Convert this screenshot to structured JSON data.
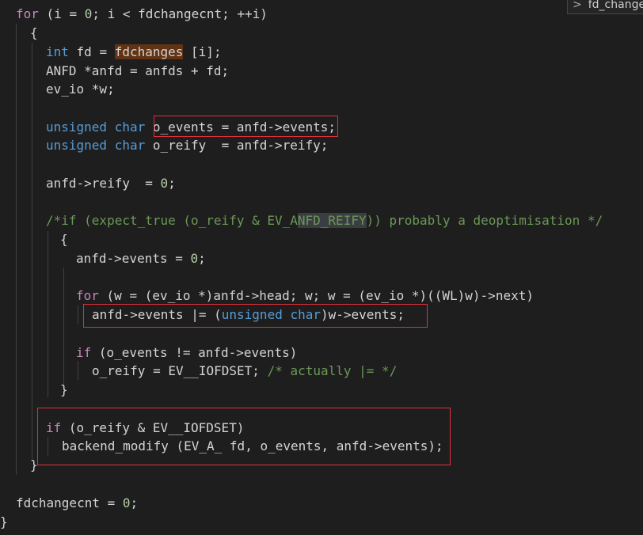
{
  "breadcrumb": {
    "chevron": "chevron-right-icon",
    "label": "fd_changes"
  },
  "code": {
    "l1": {
      "kw": "for",
      "rest1": " (i = ",
      "n0": "0",
      "rest2": "; i < fdchangecnt; ++i)"
    },
    "l2": {
      "t": "{"
    },
    "l3": {
      "kw": "int",
      "a": " fd = ",
      "hl": "fdchanges",
      "b": " [i];"
    },
    "l4": {
      "t": "ANFD *anfd = anfds + fd;"
    },
    "l5": {
      "t": "ev_io *w;"
    },
    "l6": {
      "kw": "unsigned char",
      "a": " o_events = anfd->events;"
    },
    "l7": {
      "kw": "unsigned char",
      "a": " o_reify  = anfd->reify;"
    },
    "l8": {
      "a": "anfd->reify  = ",
      "n": "0",
      "b": ";"
    },
    "l9": {
      "t1": "/*if (expect_true (o_reify & EV_A",
      "sel": "NFD_REIFY",
      "t2": ")) probably a deoptimisation */"
    },
    "l10": {
      "t": "{"
    },
    "l11": {
      "a": "anfd->events = ",
      "n": "0",
      "b": ";"
    },
    "l12": {
      "kw": "for",
      "a": " (w = (ev_io *)anfd->head; w; w = (ev_io *)((WL)w)->next)"
    },
    "l13": {
      "a": "anfd->events |= (",
      "kw": "unsigned char",
      "b": ")w->events;"
    },
    "l14": {
      "kw": "if",
      "a": " (o_events != anfd->events)"
    },
    "l15": {
      "a": "o_reify = EV__IOFDSET; ",
      "c": "/* actually |= */"
    },
    "l16": {
      "t": "}"
    },
    "l17": {
      "kw": "if",
      "a": " (o_reify & EV__IOFDSET)"
    },
    "l18": {
      "a": "backend_modify (EV_A_ fd, o_events, anfd->events);"
    },
    "l19": {
      "t": "}"
    },
    "l20": {
      "a": "fdchangecnt = ",
      "n": "0",
      "b": ";"
    },
    "l21": {
      "t": "}"
    }
  },
  "colors": {
    "background": "#1e1e1e",
    "keyword": "#569cd6",
    "control_keyword": "#c586c0",
    "variable": "#9cdcfe",
    "number": "#b5cea8",
    "comment": "#6a9955",
    "annotation_box": "#e0303a"
  }
}
